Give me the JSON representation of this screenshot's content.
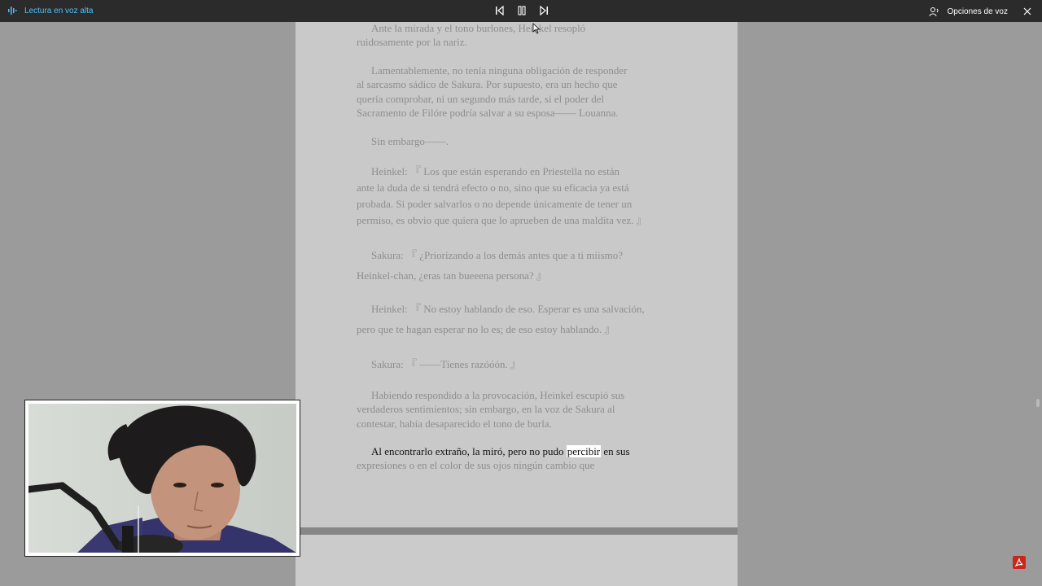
{
  "toolbar": {
    "read_aloud_label": "Lectura en voz alta",
    "voice_options_label": "Opciones de voz",
    "colors": {
      "bg": "#2b2b2b",
      "accent": "#4cc2ff"
    }
  },
  "document": {
    "paragraphs": [
      {
        "id": "p1",
        "lines": [
          "Ante la mirada y el tono burlones, Heinkel resopló",
          "ruidosamente por la nariz."
        ]
      },
      {
        "id": "p2",
        "lines": [
          "Lamentablemente, no tenía ninguna obligación de responder",
          "al sarcasmo sádico de Sakura. Por supuesto, era un hecho que",
          "quería comprobar, ni un segundo más tarde, si el poder del",
          "Sacramento de Filóre podría salvar a su esposa—— Louanna."
        ]
      },
      {
        "id": "p3",
        "lines": [
          "Sin embargo——."
        ]
      },
      {
        "id": "p4",
        "lines": [
          "Heinkel: 『 Los que están esperando en Priestella no están",
          "ante la duda de si tendrá efecto o no, sino que su eficacia ya está",
          "probada. Si poder salvarlos o no depende únicamente de tener un",
          "permiso, es obvio que quiera que lo aprueben de una maldita vez. 』"
        ]
      },
      {
        "id": "p5",
        "lines": [
          "Sakura: 『 ¿Priorizando a los demás antes que a ti miismo?",
          "Heinkel-chan, ¿eras tan bueeena persona? 』"
        ]
      },
      {
        "id": "p6",
        "lines": [
          "Heinkel: 『 No estoy hablando de eso. Esperar es una salvación,",
          "pero que te hagan esperar no lo es; de eso estoy hablando. 』"
        ]
      },
      {
        "id": "p7",
        "lines": [
          "Sakura: 『 ——Tienes razóóón. 』"
        ]
      },
      {
        "id": "p8",
        "lines": [
          "Habiendo respondido a la provocación, Heinkel escupió sus",
          "verdaderos sentimientos; sin embargo, en la voz de Sakura al",
          "contestar, había desaparecido el tono de burla."
        ]
      },
      {
        "id": "p9",
        "active_before": "Al encontrarlo extraño, la miró, pero no pudo ",
        "active_word": "percibir",
        "active_after": " en sus",
        "line2": "expresiones o en el color de sus ojos ningún cambio que"
      }
    ]
  },
  "icons": {
    "read_aloud": "audio-wave-icon",
    "previous": "skip-previous-icon",
    "pause": "pause-icon",
    "next": "skip-next-icon",
    "voice_options": "voice-options-icon",
    "close": "close-icon",
    "pdf": "pdf-icon"
  }
}
